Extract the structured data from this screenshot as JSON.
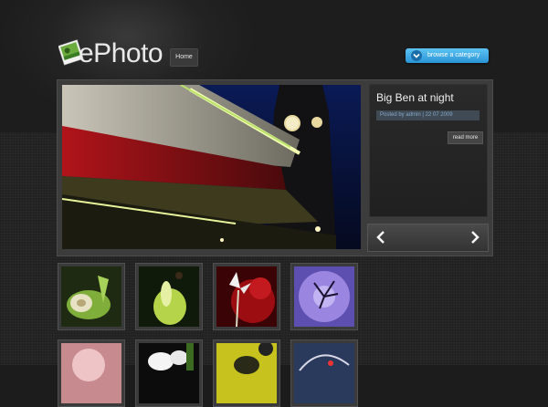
{
  "app": {
    "logo_text": "ePhoto"
  },
  "nav": {
    "items": [
      {
        "label": "Home"
      }
    ]
  },
  "header": {
    "browse_label": "browse a category"
  },
  "featured": {
    "title": "Big Ben at night",
    "meta": "Posted by admin | 22 07 2009",
    "read_more": "read more"
  },
  "icons": {
    "logo": "photo-stack-icon",
    "browse": "chevron-down-icon",
    "prev": "arrow-left-icon",
    "next": "arrow-right-icon"
  },
  "colors": {
    "accent": "#2a93d6",
    "background": "#1c1c1c"
  },
  "thumbnails": [
    "garlic-bulb",
    "green-flower",
    "white-flower-red-background",
    "purple-flower",
    "pink-flower",
    "white-flower",
    "yellow-flower-bee",
    "dark-sky"
  ]
}
